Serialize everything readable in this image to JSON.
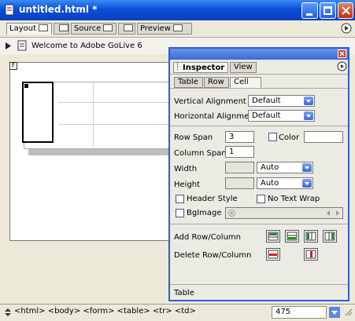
{
  "window": {
    "title": "untitled.html *"
  },
  "tabs": [
    {
      "label": "Layout"
    },
    {
      "label": "Source"
    },
    {
      "label": "Preview"
    }
  ],
  "document": {
    "page_title": "Welcome to Adobe GoLive 6"
  },
  "canvas": {
    "form_marker": "F"
  },
  "inspector": {
    "tabs": [
      {
        "label": "Inspector"
      },
      {
        "label": "View"
      }
    ],
    "subtabs": [
      {
        "label": "Table"
      },
      {
        "label": "Row"
      },
      {
        "label": "Cell"
      }
    ],
    "vertical_alignment": {
      "label": "Vertical Alignment",
      "value": "Default"
    },
    "horizontal_alignment": {
      "label": "Horizontal Alignment",
      "value": "Default"
    },
    "row_span": {
      "label": "Row Span",
      "value": "3"
    },
    "color": {
      "label": "Color"
    },
    "column_span": {
      "label": "Column Span",
      "value": "1"
    },
    "width": {
      "label": "Width",
      "value": "",
      "unit": "Auto"
    },
    "height": {
      "label": "Height",
      "value": "",
      "unit": "Auto"
    },
    "header_style": {
      "label": "Header Style"
    },
    "no_text_wrap": {
      "label": "No Text Wrap"
    },
    "bgimage": {
      "label": "BgImage"
    },
    "add_row_column": {
      "label": "Add Row/Column"
    },
    "delete_row_column": {
      "label": "Delete Row/Column"
    },
    "footer": "Table"
  },
  "statusbar": {
    "tag_path": "<html> <body> <form> <table> <tr> <td>",
    "width_value": "475"
  },
  "colors": {
    "titlebar": "#0a4fd8",
    "accent": "#2f5fd0"
  }
}
